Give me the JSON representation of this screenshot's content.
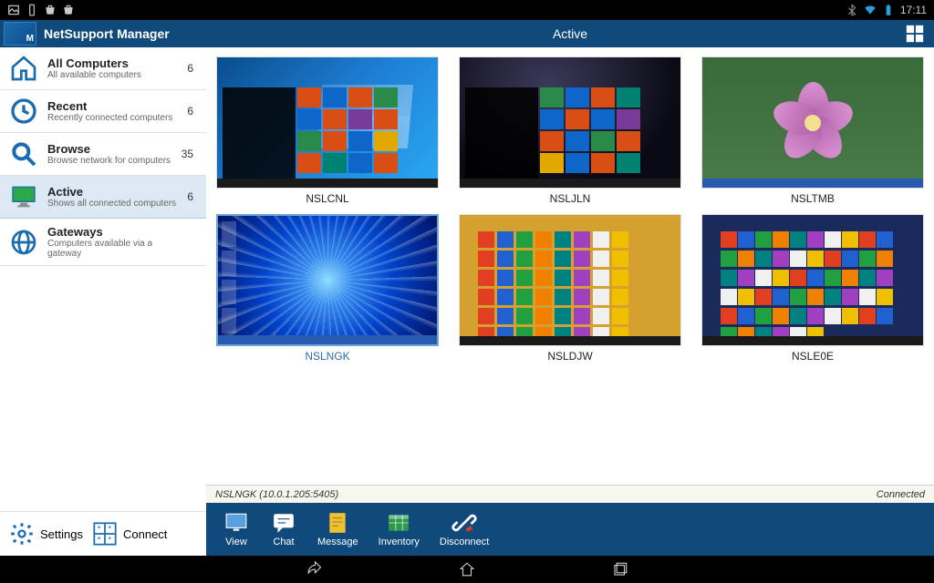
{
  "status": {
    "clock": "17:11"
  },
  "app": {
    "title": "NetSupport Manager",
    "logo_letter": "M"
  },
  "sidebar": {
    "items": [
      {
        "id": "all",
        "title": "All Computers",
        "desc": "All available computers",
        "count": "6"
      },
      {
        "id": "recent",
        "title": "Recent",
        "desc": "Recently connected computers",
        "count": "6"
      },
      {
        "id": "browse",
        "title": "Browse",
        "desc": "Browse network for computers",
        "count": "35"
      },
      {
        "id": "active",
        "title": "Active",
        "desc": "Shows all connected computers",
        "count": "6",
        "selected": true
      },
      {
        "id": "gateways",
        "title": "Gateways",
        "desc": "Computers available via a gateway",
        "count": ""
      }
    ]
  },
  "bottom": {
    "settings": "Settings",
    "connect": "Connect"
  },
  "content": {
    "header": "Active",
    "status_name": "NSLNGK (10.0.1.205:5405)",
    "status_state": "Connected",
    "computers": [
      {
        "name": "NSLCNL",
        "preview": "win10a"
      },
      {
        "name": "NSLJLN",
        "preview": "dark"
      },
      {
        "name": "NSLTMB",
        "preview": "flower"
      },
      {
        "name": "NSLNGK",
        "preview": "burst",
        "selected": true
      },
      {
        "name": "NSLDJW",
        "preview": "ochre"
      },
      {
        "name": "NSLE0E",
        "preview": "navy"
      }
    ]
  },
  "toolbar": [
    {
      "id": "view",
      "label": "View"
    },
    {
      "id": "chat",
      "label": "Chat"
    },
    {
      "id": "message",
      "label": "Message"
    },
    {
      "id": "inventory",
      "label": "Inventory"
    },
    {
      "id": "disconnect",
      "label": "Disconnect"
    }
  ]
}
